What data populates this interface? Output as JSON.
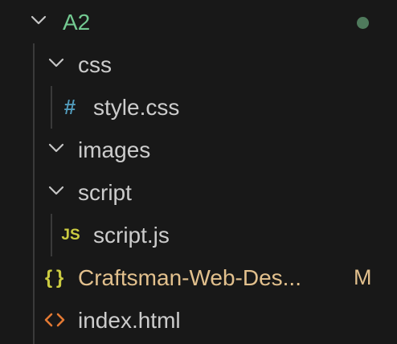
{
  "colors": {
    "background": "#181818",
    "folder_modified": "#73c991",
    "folder_text": "#cccccc",
    "css_icon": "#519aba",
    "js_icon": "#cbcb41",
    "json_icon": "#cbcb41",
    "html_icon": "#e37933",
    "modified_file": "#e2c08d",
    "modified_dot": "#4f7a5c"
  },
  "explorer": {
    "root": {
      "label": "A2",
      "icon": "chevron-down-icon",
      "status_icon": "modified-dot-icon"
    },
    "items": [
      {
        "label": "css",
        "kind": "folder",
        "icon": "chevron-down-icon"
      },
      {
        "label": "style.css",
        "kind": "file",
        "icon_glyph": "#",
        "icon": "css-file-icon"
      },
      {
        "label": "images",
        "kind": "folder",
        "icon": "chevron-down-icon"
      },
      {
        "label": "script",
        "kind": "folder",
        "icon": "chevron-down-icon"
      },
      {
        "label": "script.js",
        "kind": "file",
        "icon_glyph": "JS",
        "icon": "js-file-icon"
      },
      {
        "label": "Craftsman-Web-Des...",
        "kind": "file",
        "icon_glyph": "{ }",
        "icon": "json-file-icon",
        "badge": "M"
      },
      {
        "label": "index.html",
        "kind": "file",
        "icon_glyph": "<>",
        "icon": "html-file-icon"
      }
    ]
  }
}
